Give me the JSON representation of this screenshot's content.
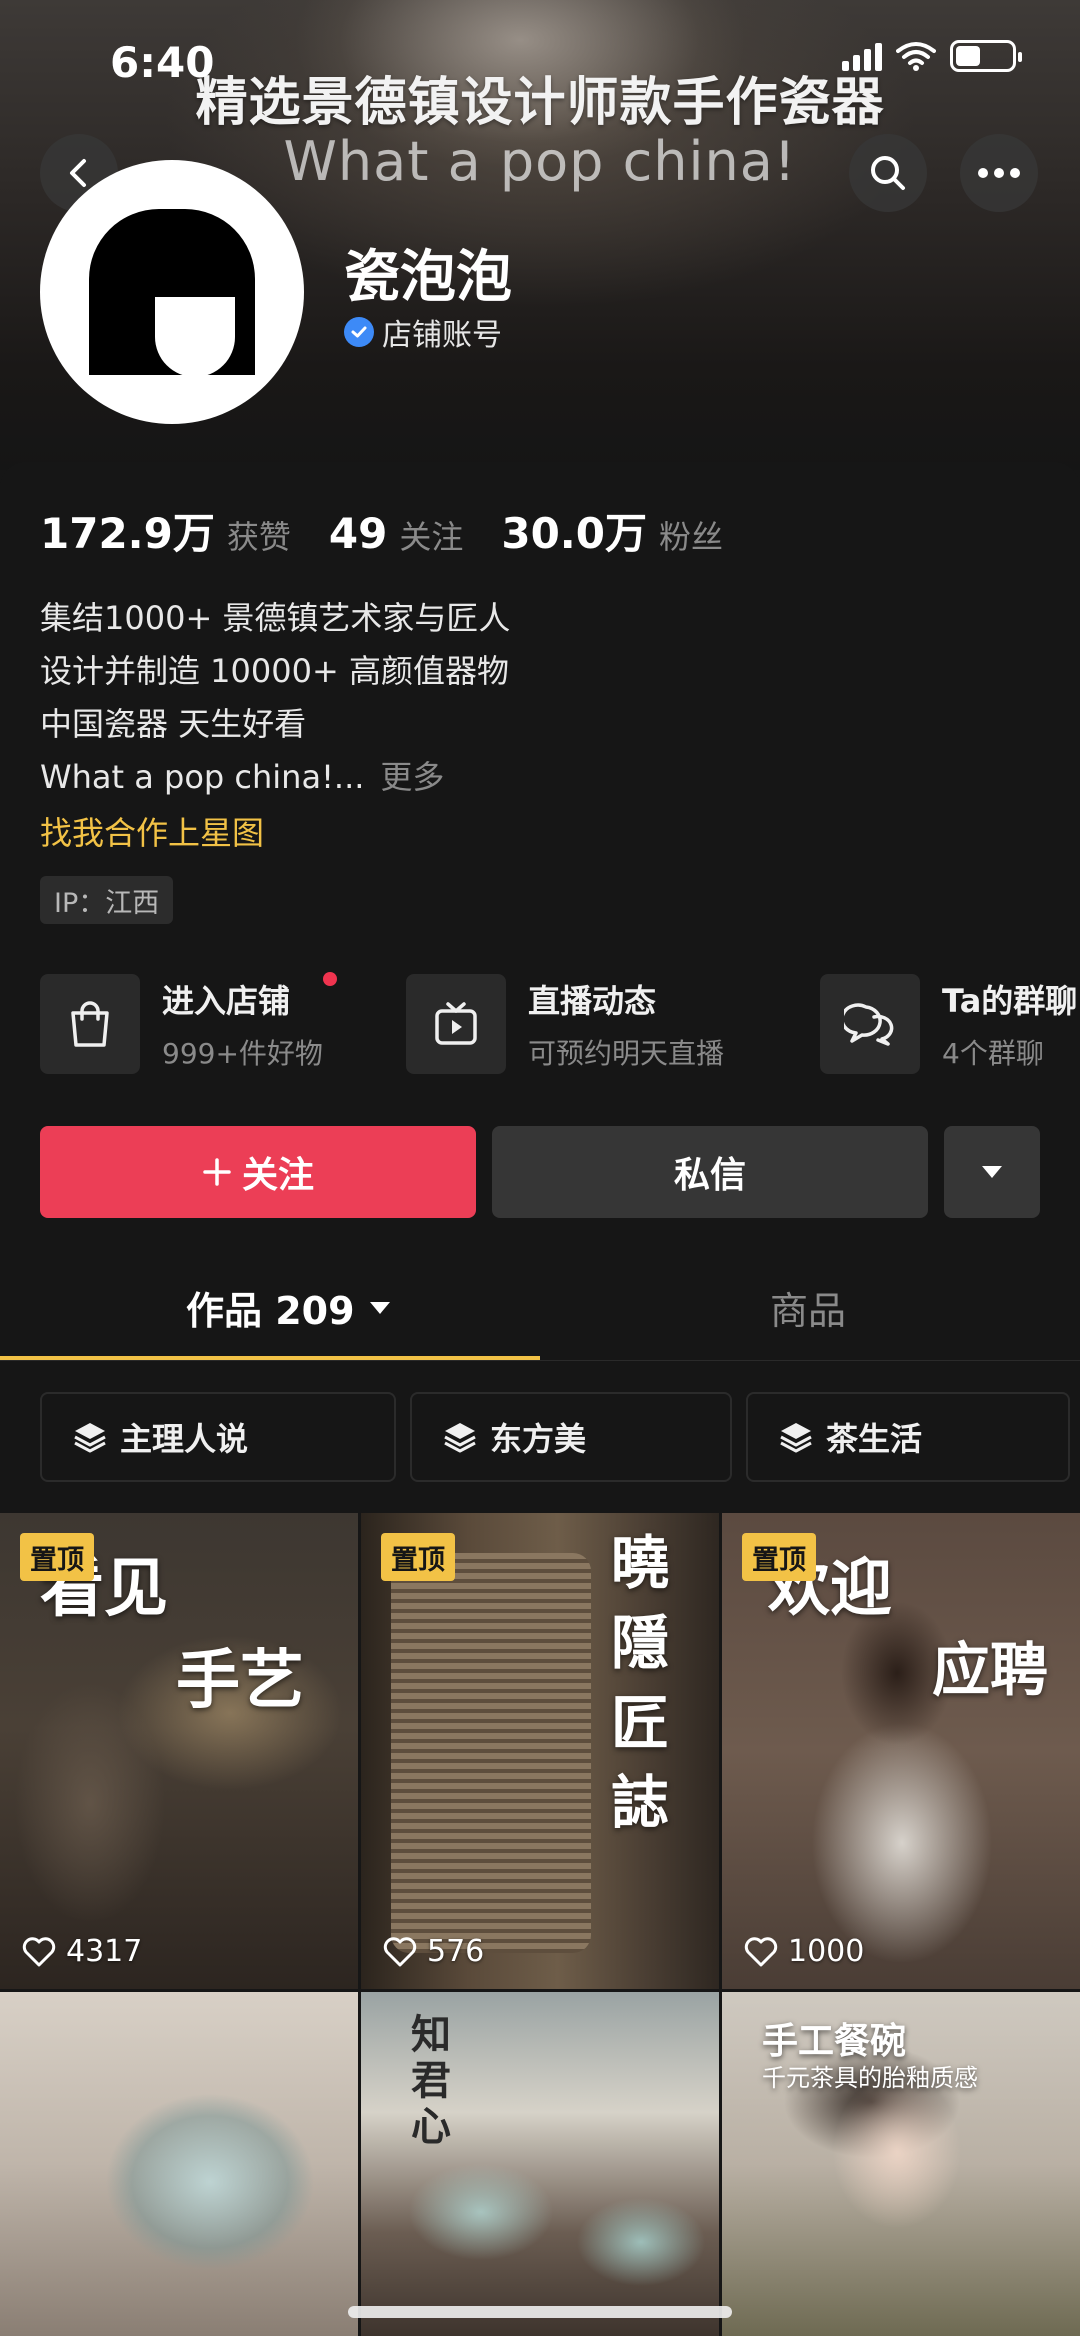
{
  "status_bar": {
    "time": "6:40"
  },
  "banner": {
    "title": "精选景德镇设计师款手作瓷器",
    "subtitle": "What a pop china!"
  },
  "profile": {
    "name": "瓷泡泡",
    "account_type": "店铺账号",
    "stats": [
      {
        "value": "172.9万",
        "label": "获赞"
      },
      {
        "value": "49",
        "label": "关注"
      },
      {
        "value": "30.0万",
        "label": "粉丝"
      }
    ],
    "bio_lines": [
      "集结1000+ 景德镇艺术家与匠人",
      "设计并制造 10000+ 高颜值器物",
      "中国瓷器 天生好看",
      "What a pop china!..."
    ],
    "bio_more": "更多",
    "collab_link": "找我合作上星图",
    "ip": "IP：江西"
  },
  "entries": [
    {
      "title": "进入店铺",
      "subtitle": "999+件好物",
      "icon": "shopping-bag-icon"
    },
    {
      "title": "直播动态",
      "subtitle": "可预约明天直播",
      "icon": "live-tv-icon"
    },
    {
      "title": "Ta的群聊",
      "subtitle": "4个群聊",
      "icon": "group-chat-icon"
    }
  ],
  "actions": {
    "follow": "关注",
    "message": "私信"
  },
  "tabs": {
    "works": "作品 209",
    "goods": "商品"
  },
  "collections": [
    "主理人说",
    "东方美",
    "茶生活"
  ],
  "videos": [
    {
      "pinned": true,
      "pin_label": "置顶",
      "likes": "4317",
      "overlay": [
        "看见",
        "手艺"
      ]
    },
    {
      "pinned": true,
      "pin_label": "置顶",
      "likes": "576",
      "overlay": [
        "曉",
        "隱",
        "匠",
        "誌"
      ]
    },
    {
      "pinned": true,
      "pin_label": "置顶",
      "likes": "1000",
      "overlay": [
        "欢迎",
        "应聘"
      ]
    },
    {
      "pinned": false,
      "overlay": []
    },
    {
      "pinned": false,
      "overlay": [
        "知",
        "君",
        "心"
      ]
    },
    {
      "pinned": false,
      "overlay": [
        "手工餐碗",
        "千元茶具的胎釉质感"
      ]
    }
  ],
  "colors": {
    "background": "#161616",
    "accent_yellow": "#f2c246",
    "follow_red": "#ec3e56",
    "muted_text": "#8a8a8a",
    "verified_blue": "#3d8af7"
  }
}
